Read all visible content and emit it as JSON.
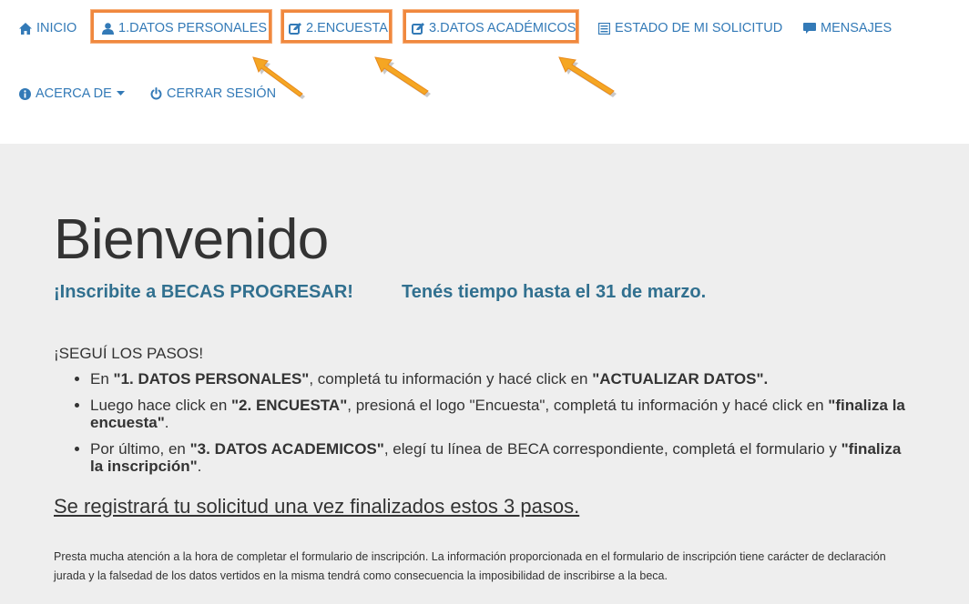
{
  "nav": {
    "inicio": "INICIO",
    "datos_personales": "1.DATOS PERSONALES",
    "encuesta": "2.ENCUESTA",
    "datos_academicos": "3.DATOS ACADÉMICOS",
    "estado": "ESTADO DE MI SOLICITUD",
    "mensajes": "MENSAJES",
    "acerca": "ACERCA DE",
    "cerrar": "CERRAR SESIÓN"
  },
  "icons": {
    "inicio": "home-icon",
    "datos_personales": "user-icon",
    "encuesta": "edit-icon",
    "datos_academicos": "edit-icon",
    "estado": "list-icon",
    "mensajes": "comment-icon",
    "acerca": "info-icon",
    "cerrar": "power-icon"
  },
  "colors": {
    "link": "#337ab7",
    "subtitle": "#31708f",
    "highlight": "#f0883e",
    "arrow": "#f5a623",
    "background": "#eeeeee"
  },
  "main": {
    "title": "Bienvenido",
    "subtitle_left": "¡Inscribite a BECAS PROGRESAR!",
    "subtitle_right": "Tenés tiempo hasta el 31 de marzo.",
    "steps_heading": "¡SEGUÍ LOS PASOS!",
    "steps": [
      {
        "parts": [
          {
            "t": "En ",
            "b": false
          },
          {
            "t": "\"1. DATOS PERSONALES\"",
            "b": true
          },
          {
            "t": ", completá tu información y hacé click en ",
            "b": false
          },
          {
            "t": "\"ACTUALIZAR DATOS\".",
            "b": true
          }
        ]
      },
      {
        "parts": [
          {
            "t": "Luego hace click en ",
            "b": false
          },
          {
            "t": "\"2. ENCUESTA\"",
            "b": true
          },
          {
            "t": ", presioná el logo \"Encuesta\", completá tu información y hacé click en ",
            "b": false
          },
          {
            "t": "\"finaliza la encuesta\"",
            "b": true
          },
          {
            "t": ".",
            "b": false
          }
        ]
      },
      {
        "parts": [
          {
            "t": "Por último, en ",
            "b": false
          },
          {
            "t": "\"3. DATOS ACADEMICOS\"",
            "b": true
          },
          {
            "t": ", elegí tu línea de BECA correspondiente, completá el formulario y ",
            "b": false
          },
          {
            "t": "\"finaliza la inscripción\"",
            "b": true
          },
          {
            "t": ".",
            "b": false
          }
        ]
      }
    ],
    "note": "Se registrará tu solicitud una vez finalizados estos 3 pasos.",
    "legal": "Presta mucha atención a la hora de completar el formulario de inscripción. La información proporcionada en el formulario de inscripción tiene carácter de declaración jurada y la falsedad de los datos vertidos en la misma tendrá como consecuencia la imposibilidad de inscribirse a la beca."
  }
}
